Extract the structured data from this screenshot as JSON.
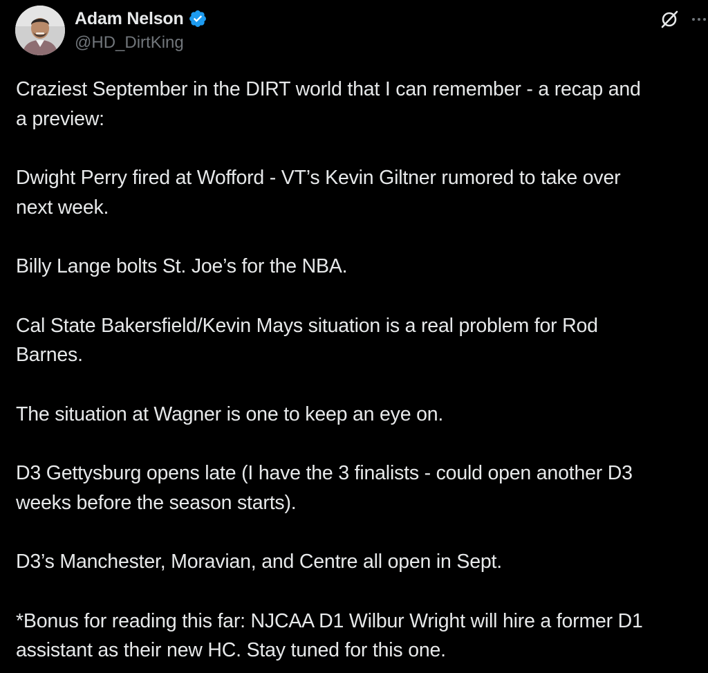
{
  "author": {
    "display_name": "Adam Nelson",
    "handle": "@HD_DirtKing",
    "verified": true,
    "avatar_icon": "avatar-photo"
  },
  "header_icons": {
    "grok": "grok-icon",
    "more": "more-icon"
  },
  "colors": {
    "background": "#000000",
    "text": "#e7e9ea",
    "secondary_text": "#71767b",
    "verified_badge": "#1d9bf0"
  },
  "tweet": {
    "paragraphs": [
      "Craziest September in the DIRT world that I can remember - a recap and\na preview:",
      "Dwight Perry fired at Wofford - VT’s Kevin Giltner rumored to take over\nnext week.",
      "Billy Lange bolts St. Joe’s for the NBA.",
      "Cal State Bakersfield/Kevin Mays situation is a real problem for Rod\nBarnes.",
      "The situation at Wagner is one to keep an eye on.",
      "D3 Gettysburg opens late (I have the 3 finalists - could open another D3\nweeks before the season starts).",
      "D3’s Manchester, Moravian, and Centre all open in Sept.",
      "*Bonus for reading this far: NJCAA D1 Wilbur Wright will hire a former D1\nassistant as their new HC. Stay tuned for this one."
    ]
  }
}
